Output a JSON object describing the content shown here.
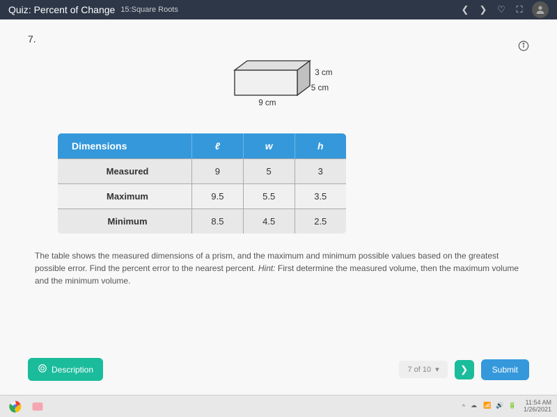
{
  "header": {
    "title": "Quiz: Percent of Change",
    "subtitle": "15:Square Roots"
  },
  "question": {
    "number": "7.",
    "prism": {
      "length": "9 cm",
      "width": "5 cm",
      "height": "3 cm"
    },
    "table": {
      "headers": [
        "Dimensions",
        "ℓ",
        "w",
        "h"
      ],
      "rows": [
        {
          "label": "Measured",
          "l": "9",
          "w": "5",
          "h": "3"
        },
        {
          "label": "Maximum",
          "l": "9.5",
          "w": "5.5",
          "h": "3.5"
        },
        {
          "label": "Minimum",
          "l": "8.5",
          "w": "4.5",
          "h": "2.5"
        }
      ]
    },
    "text": "The table shows the measured dimensions of a prism, and the maximum and minimum possible values based on the greatest possible error. Find the percent error to the nearest percent.",
    "hint_label": "Hint:",
    "hint": "First determine the measured volume, then the maximum volume and the minimum volume."
  },
  "footer": {
    "description": "Description",
    "pager": "7 of 10",
    "submit": "Submit"
  },
  "taskbar": {
    "time": "11:54 AM",
    "date": "1/26/2021"
  }
}
